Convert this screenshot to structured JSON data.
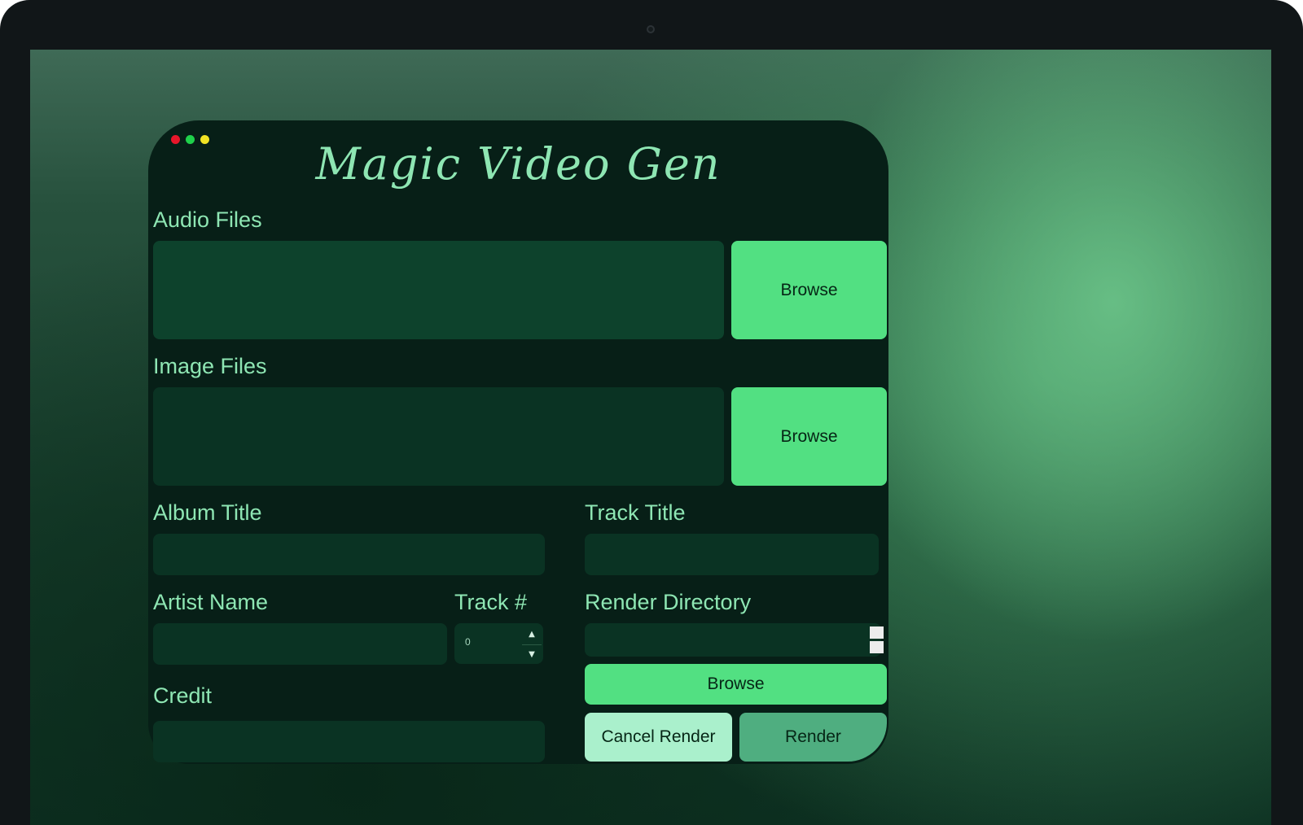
{
  "window": {
    "title": "Magic Video Gen",
    "controls": [
      "close",
      "maximize",
      "minimize"
    ]
  },
  "audio": {
    "label": "Audio Files",
    "value": "",
    "browse_label": "Browse"
  },
  "image": {
    "label": "Image Files",
    "value": "",
    "browse_label": "Browse"
  },
  "album": {
    "label": "Album Title",
    "value": ""
  },
  "track_title": {
    "label": "Track Title",
    "value": ""
  },
  "artist": {
    "label": "Artist Name",
    "value": ""
  },
  "track_number": {
    "label": "Track #",
    "value": "0"
  },
  "render_dir": {
    "label": "Render Directory",
    "value": "",
    "browse_label": "Browse"
  },
  "credit": {
    "label": "Credit",
    "value": ""
  },
  "actions": {
    "cancel_label": "Cancel Render",
    "render_label": "Render"
  },
  "colors": {
    "accent": "#52e082",
    "label_text": "#8ee6b3",
    "window_bg": "#071f17",
    "field_bg": "#0a3323"
  },
  "icons": {
    "spin_up": "▲",
    "spin_down": "▼"
  }
}
